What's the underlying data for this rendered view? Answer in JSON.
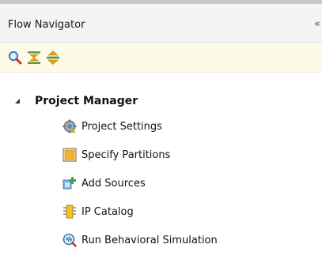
{
  "panel": {
    "title": "Flow Navigator",
    "chevron": "«"
  },
  "toolbar": {
    "buttons": [
      {
        "name": "search",
        "icon": "search-icon"
      },
      {
        "name": "collapse-all",
        "icon": "collapse-all-icon"
      },
      {
        "name": "expand-all",
        "icon": "expand-all-icon"
      }
    ]
  },
  "tree": {
    "section": {
      "label": "Project Manager",
      "expanded": true,
      "items": [
        {
          "label": "Project Settings",
          "icon": "gear-icon"
        },
        {
          "label": "Specify Partitions",
          "icon": "partition-icon"
        },
        {
          "label": "Add Sources",
          "icon": "add-sources-icon"
        },
        {
          "label": "IP Catalog",
          "icon": "ip-chip-icon"
        },
        {
          "label": "Run Behavioral Simulation",
          "icon": "simulation-icon"
        }
      ]
    }
  },
  "colors": {
    "toolbar_bg": "#fdfbe8",
    "title_bg": "#f4f4f4",
    "accent_green": "#6aa84f",
    "accent_orange": "#e8a21a"
  }
}
